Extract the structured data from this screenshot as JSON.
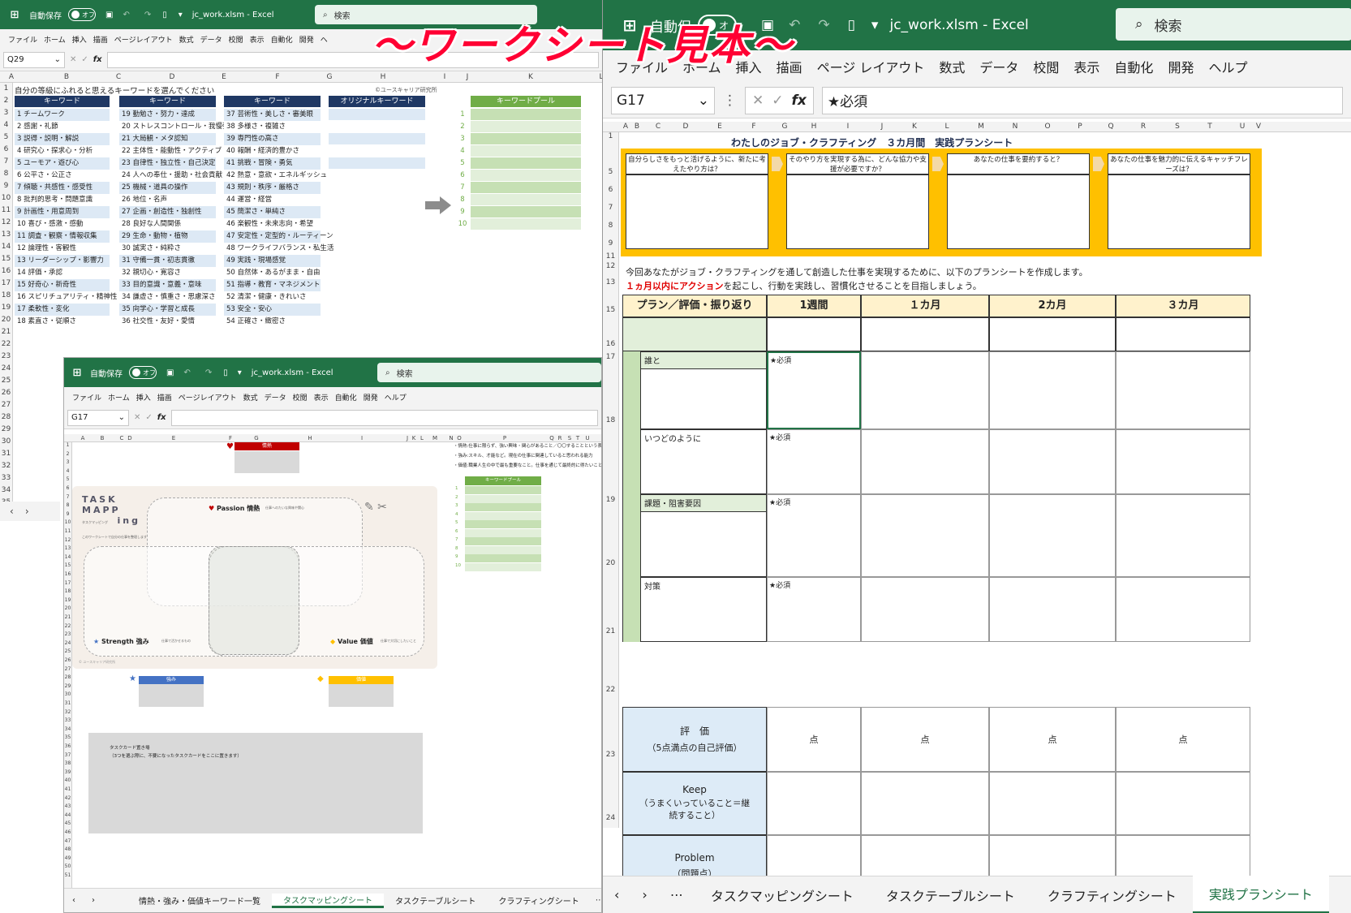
{
  "banner": "〜ワークシート見本〜",
  "win1": {
    "autosave": "自動保存",
    "toggle": "オフ",
    "title": "jc_work.xlsm - Excel",
    "search": "検索",
    "menu": [
      "ファイル",
      "ホーム",
      "挿入",
      "描画",
      "ページレイアウト",
      "数式",
      "データ",
      "校閲",
      "表示",
      "自動化",
      "開発",
      "ヘ"
    ],
    "namebox": "Q29",
    "columns": [
      "A",
      "B",
      "C",
      "D",
      "E",
      "F",
      "G",
      "H",
      "I",
      "J",
      "K",
      "L"
    ],
    "rows": [
      "1",
      "2",
      "3",
      "4",
      "5",
      "6",
      "7",
      "8",
      "9",
      "10",
      "11",
      "12",
      "13",
      "14",
      "15",
      "16",
      "17",
      "18",
      "19",
      "20",
      "21",
      "22",
      "23",
      "24",
      "25",
      "26",
      "27",
      "28",
      "29",
      "30",
      "31",
      "32",
      "33",
      "34",
      "35",
      "36"
    ],
    "sheet_title": "自分の等級にふれると思えるキーワードを選んでください",
    "copyright": "©ユースキャリア研究所",
    "headers": [
      "キーワード",
      "キーワード",
      "キーワード",
      "オリジナルキーワード",
      "キーワードプール"
    ],
    "col1": [
      "1 チームワーク",
      "2 感謝・礼節",
      "3 説得・説明・解説",
      "4 研究心・探求心・分析",
      "5 ユーモア・遊び心",
      "6 公平さ・公正さ",
      "7 傾聴・共感性・感受性",
      "8 批判的思考・問題意識",
      "9 計画性・用意周到",
      "10 喜び・感激・感動",
      "11 調査・観察・情報収集",
      "12 論理性・客観性",
      "13 リーダーシップ・影響力",
      "14 評価・承認",
      "15 好奇心・新奇性",
      "16 スピリチュアリティ・精神性",
      "17 柔軟性・変化",
      "18 素直さ・従順さ"
    ],
    "col2": [
      "19 勤勉さ・努力・達成",
      "20 ストレスコントロール・我慢強さ",
      "21 大局観・メタ認知",
      "22 主体性・能動性・アクティブ",
      "23 自律性・独立性・自己決定",
      "24 人への奉仕・援助・社会貢献",
      "25 機械・道具の操作",
      "26 地位・名声",
      "27 企画・創造性・独創性",
      "28 良好な人間関係",
      "29 生命・動物・植物",
      "30 誠実さ・純粋さ",
      "31 守備一貫・初志貫徹",
      "32 親切心・寛容さ",
      "33 目的意識・意義・意味",
      "34 謙虚さ・慎重さ・思慮深さ",
      "35 向学心・学習と成長",
      "36 社交性・友好・愛情"
    ],
    "col3": [
      "37 芸術性・美しさ・審美眼",
      "38 多様さ・複雑さ",
      "39 専門性の高さ",
      "40 報酬・経済的豊かさ",
      "41 挑戦・冒険・勇気",
      "42 熱意・意欲・エネルギッシュ",
      "43 規則・秩序・厳格さ",
      "44 運営・経営",
      "45 簡潔さ・単純さ",
      "46 楽観性・未来志向・希望",
      "47 安定性・定型的・ルーティーン",
      "48 ワークライフバランス・私生活",
      "49 実践・現場感覚",
      "50 自然体・あるがまま・自由",
      "51 指導・教育・マネジメント",
      "52 清潔・健康・きれいさ",
      "53 安全・安心",
      "54 正確さ・緻密さ"
    ],
    "pool_nums": [
      "1",
      "2",
      "3",
      "4",
      "5",
      "6",
      "7",
      "8",
      "9",
      "10"
    ]
  },
  "win2": {
    "autosave": "自動保存",
    "toggle": "オフ",
    "title": "jc_work.xlsm - Excel",
    "search": "検索",
    "menu": [
      "ファイル",
      "ホーム",
      "挿入",
      "描画",
      "ページレイアウト",
      "数式",
      "データ",
      "校閲",
      "表示",
      "自動化",
      "開発",
      "ヘルプ"
    ],
    "namebox": "G17",
    "columns": [
      "A",
      "B",
      "C",
      "D",
      "E",
      "F",
      "G",
      "H",
      "I",
      "J",
      "K",
      "L",
      "M",
      "N",
      "O",
      "P",
      "Q",
      "R",
      "S",
      "T",
      "U"
    ],
    "rows": [
      "1",
      "2",
      "3",
      "4",
      "5",
      "6",
      "7",
      "8",
      "9",
      "10",
      "11",
      "12",
      "13",
      "14",
      "15",
      "16",
      "17",
      "18",
      "19",
      "20",
      "21",
      "22",
      "23",
      "24",
      "25",
      "26",
      "27",
      "28",
      "29",
      "30",
      "31",
      "32",
      "33",
      "34",
      "35",
      "36",
      "37",
      "38",
      "39",
      "40",
      "41",
      "42",
      "43",
      "44",
      "45",
      "46",
      "47",
      "48",
      "49",
      "50",
      "51"
    ],
    "notes": [
      "・情熱:仕事に限らず、強い興味・関心があること／〇〇することという表現でイメ",
      "・強み:スキル、才能など。現在の仕事に関連していると思われる能力",
      "・価値:職業人生の中で最も重要なこと。仕事を通じて最終的に得たいこと"
    ],
    "passion_label": "情熱",
    "passion_title": "Passion 情熱",
    "passion_sub": "仕事へのたいな興味や関心",
    "strength_title": "Strength 強み",
    "strength_sub": "仕事で活かせるもの",
    "value_title": "Value 価値",
    "value_sub": "仕事で大切にしたいこと",
    "logo_lines": [
      "TASK",
      "MAPP",
      "ing"
    ],
    "logo_sub": "タスクマッピング",
    "logo_note": "このワークシートで自分の仕事を整理します",
    "copyright": "© ユースキャリア研究所",
    "pool_label": "キーワードプール",
    "pool_nums": [
      "1",
      "2",
      "3",
      "4",
      "5",
      "6",
      "7",
      "8",
      "9",
      "10"
    ],
    "strength_label": "強み",
    "value_label": "価値",
    "taskcard_title": "タスクカード置き場",
    "taskcard_sub": "（3つを選ぶ際に、不要になったタスクカードをここに置きます）",
    "tabs": [
      "情熱・強み・価値キーワード一覧",
      "タスクマッピングシート",
      "タスクテーブルシート",
      "クラフティングシート"
    ],
    "active_tab": 1
  },
  "win3": {
    "autosave": "自動保",
    "toggle": "オ",
    "title": "jc_work.xlsm - Excel",
    "search": "検索",
    "menu": [
      "ファイル",
      "ホーム",
      "挿入",
      "描画",
      "ページ レイアウト",
      "数式",
      "データ",
      "校閲",
      "表示",
      "自動化",
      "開発",
      "ヘルプ"
    ],
    "namebox": "G17",
    "formula": "★必須",
    "columns": [
      "A",
      "B",
      "C",
      "D",
      "E",
      "F",
      "G",
      "H",
      "I",
      "J",
      "K",
      "L",
      "M",
      "N",
      "O",
      "P",
      "Q",
      "R",
      "S",
      "T",
      "U",
      "V"
    ],
    "sheet_title": "わたしのジョブ・クラフティング　３カ月間　実践プランシート",
    "questions": [
      "自分らしさをもっと活げるように、新たに考えたやり方は？",
      "そのやり方を実現する為に、どんな協力や支援が必要ですか？",
      "あなたの仕事を要約すると？",
      "あなたの仕事を魅力的に伝えるキャッチフレーズは？"
    ],
    "intro1": "今回あなたがジョブ・クラフティングを通して創造した仕事を実現するために、以下のプランシートを作成します。",
    "intro2_red": "１ヵ月以内にアクション",
    "intro2_rest": "を起こし、行動を実践し、習慣化させることを目指しましょう。",
    "table_headers": [
      "プラン／評価・振り返り",
      "1週間",
      "１カ月",
      "2カ月",
      "３カ月"
    ],
    "plan_labels": [
      "誰と",
      "いつどのように",
      "課題・阻害要因",
      "対策"
    ],
    "required": "★必須",
    "eval_label": "評　価",
    "eval_sub": "（5点満点の自己評価）",
    "eval_unit": "点",
    "keep_label": "Keep",
    "keep_sub": "（うまくいっていること＝継続すること）",
    "problem_label": "Problem",
    "problem_sub": "（問題点）",
    "rows": [
      "1",
      "5",
      "6",
      "7",
      "8",
      "9",
      "11",
      "12",
      "13",
      "15",
      "16",
      "17",
      "18",
      "19",
      "20",
      "21",
      "22",
      "23",
      "24",
      "25"
    ],
    "tabs": [
      "タスクマッピングシート",
      "タスクテーブルシート",
      "クラフティングシート",
      "実践プランシート"
    ],
    "active_tab": 3
  }
}
